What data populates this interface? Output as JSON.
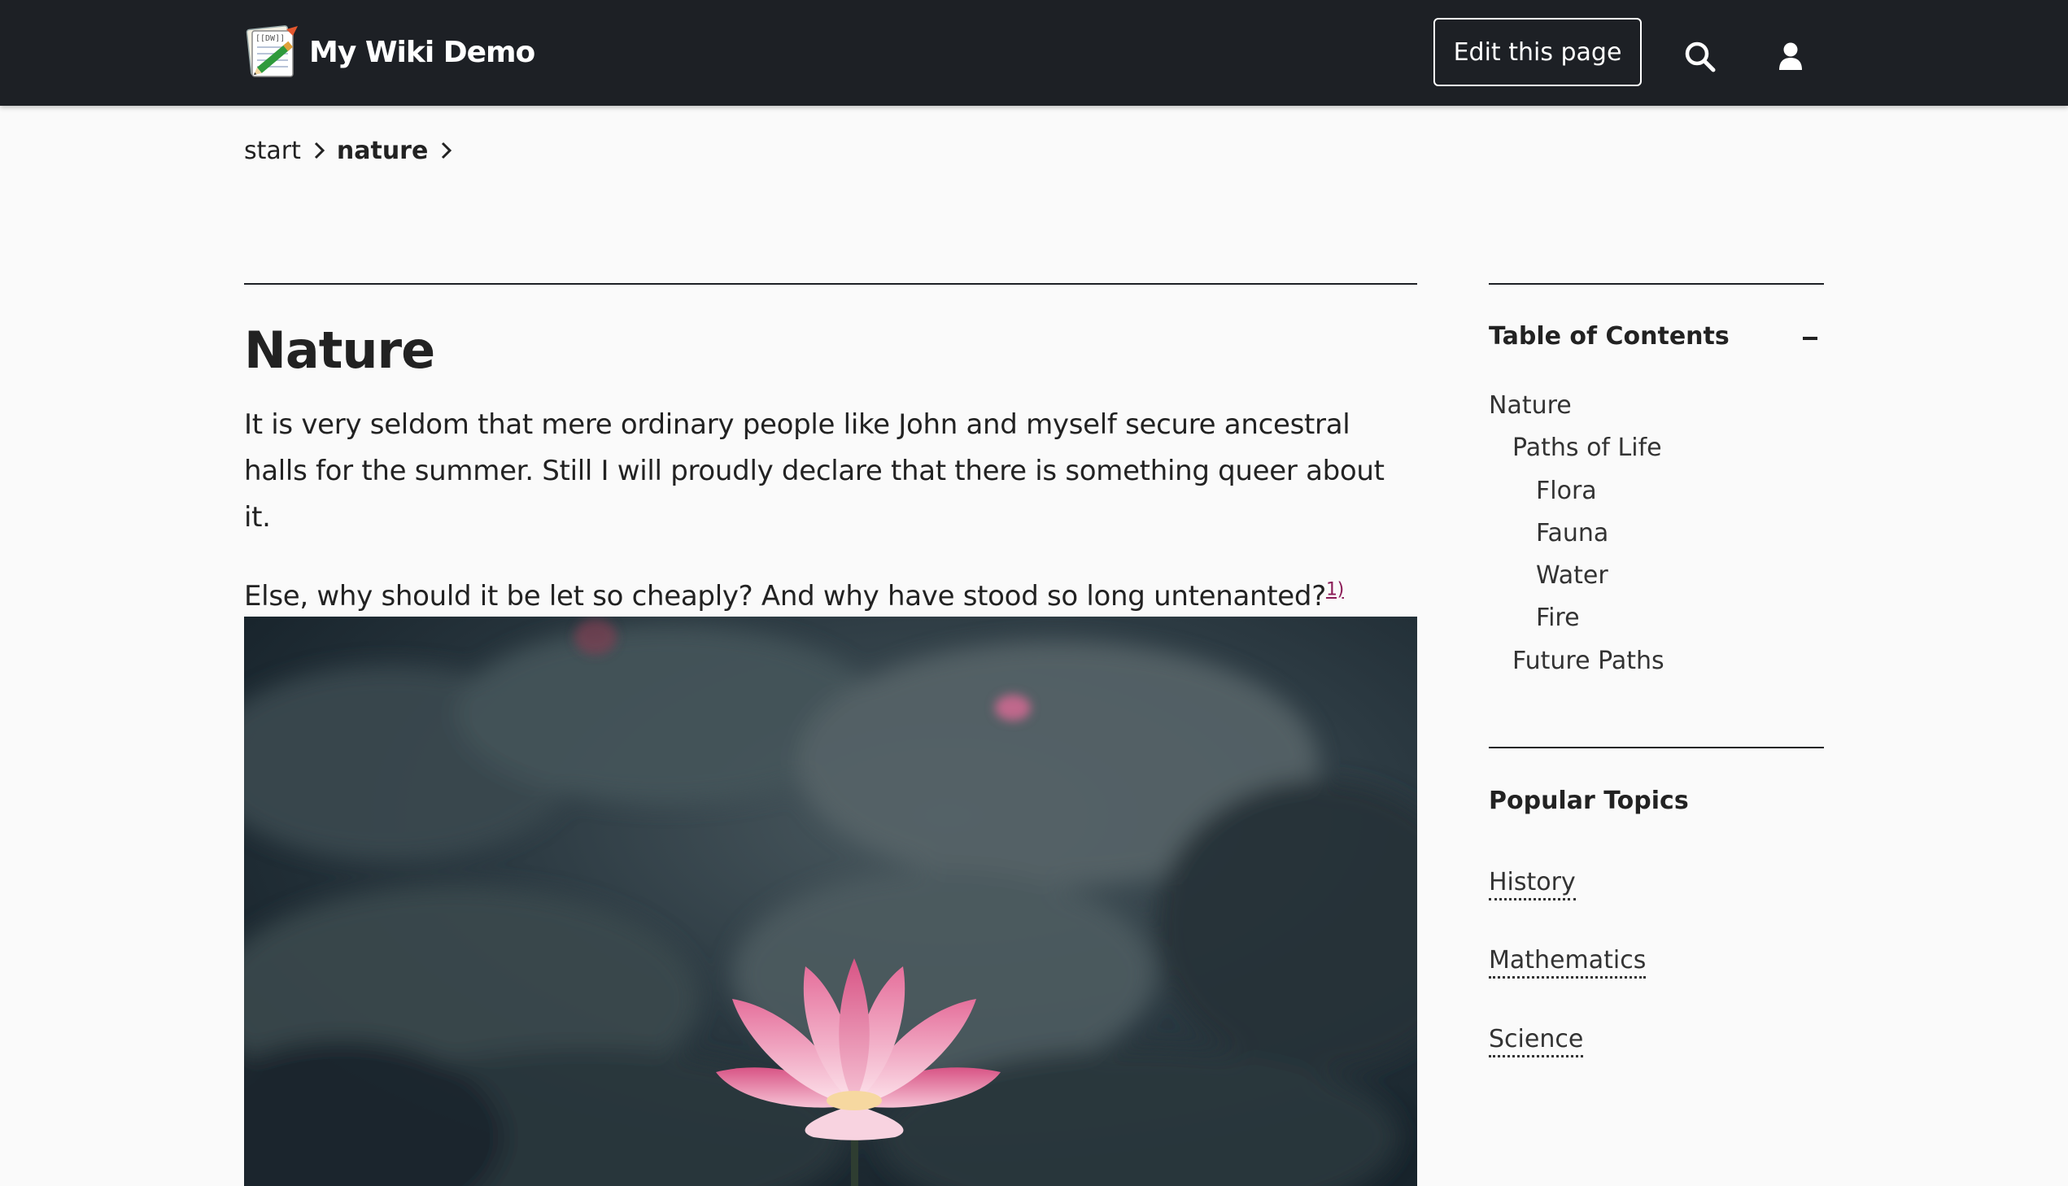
{
  "site": {
    "name": "My Wiki Demo",
    "logo_text": "[[DW]]"
  },
  "header": {
    "edit_label": "Edit this page",
    "search_icon": "search-icon",
    "user_icon": "user-icon"
  },
  "breadcrumb": {
    "items": [
      "start",
      "nature"
    ],
    "separator_icon": "chevron-right-icon"
  },
  "article": {
    "title": "Nature",
    "paragraphs": [
      "It is very seldom that mere ordinary people like John and myself secure ancestral halls for the summer. Still I will proudly declare that there is something queer about it.",
      "Else, why should it be let so cheaply? And why have stood so long untenanted?"
    ],
    "footnote_ref": "1)",
    "image_subject": "pink lotus flower among dark leaves"
  },
  "toc": {
    "title": "Table of Contents",
    "toggle_icon": "collapse-icon",
    "items": [
      {
        "label": "Nature",
        "level": 1
      },
      {
        "label": "Paths of Life",
        "level": 2
      },
      {
        "label": "Flora",
        "level": 3
      },
      {
        "label": "Fauna",
        "level": 3
      },
      {
        "label": "Water",
        "level": 3
      },
      {
        "label": "Fire",
        "level": 3
      },
      {
        "label": "Future Paths",
        "level": 2
      }
    ]
  },
  "popular": {
    "title": "Popular Topics",
    "links": [
      "History",
      "Mathematics",
      "Science"
    ]
  },
  "colors": {
    "header_bg": "#1d2025",
    "page_bg": "#fafafa",
    "footnote_link": "#8b1c57"
  }
}
